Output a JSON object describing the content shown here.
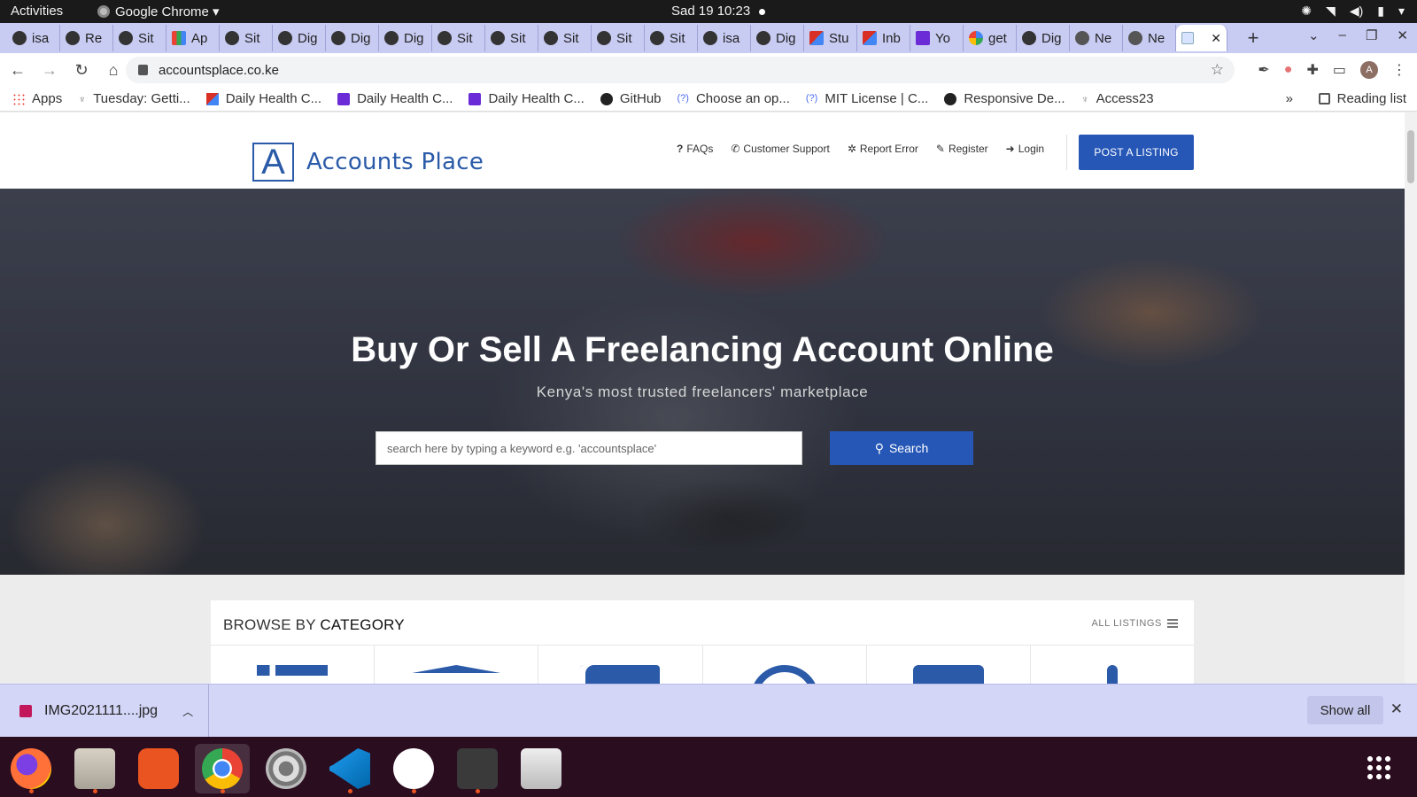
{
  "system": {
    "activities": "Activities",
    "app_menu": "Google Chrome ▾",
    "clock": "Sad 19  10:23"
  },
  "tabs": [
    {
      "label": "isa",
      "icon": "github-icon"
    },
    {
      "label": "Re",
      "icon": "github-icon"
    },
    {
      "label": "Sit",
      "icon": "github-icon"
    },
    {
      "label": "Ap",
      "icon": "apps-grid-icon"
    },
    {
      "label": "Sit",
      "icon": "github-icon"
    },
    {
      "label": "Dig",
      "icon": "github-icon"
    },
    {
      "label": "Dig",
      "icon": "github-icon"
    },
    {
      "label": "Dig",
      "icon": "github-icon"
    },
    {
      "label": "Sit",
      "icon": "github-icon"
    },
    {
      "label": "Sit",
      "icon": "github-icon"
    },
    {
      "label": "Sit",
      "icon": "github-icon"
    },
    {
      "label": "Sit",
      "icon": "github-icon"
    },
    {
      "label": "Sit",
      "icon": "github-icon"
    },
    {
      "label": "isa",
      "icon": "github-icon"
    },
    {
      "label": "Dig",
      "icon": "github-icon"
    },
    {
      "label": "Stu",
      "icon": "gmail-icon"
    },
    {
      "label": "Inb",
      "icon": "gmail-icon"
    },
    {
      "label": "Yo",
      "icon": "forms-icon"
    },
    {
      "label": "get",
      "icon": "google-icon"
    },
    {
      "label": "Dig",
      "icon": "github-icon"
    },
    {
      "label": "Ne",
      "icon": "globe-icon"
    },
    {
      "label": "Ne",
      "icon": "globe-icon"
    }
  ],
  "active_tab": {
    "label": "",
    "close": "✕"
  },
  "new_tab": "+",
  "url": "accountsplace.co.ke",
  "bookmarks": [
    {
      "label": "Apps",
      "icon": "apps"
    },
    {
      "label": "Tuesday: Getti...",
      "icon": "palm"
    },
    {
      "label": "Daily Health C...",
      "icon": "gm"
    },
    {
      "label": "Daily Health C...",
      "icon": "pu"
    },
    {
      "label": "Daily Health C...",
      "icon": "pu"
    },
    {
      "label": "GitHub",
      "icon": "gh"
    },
    {
      "label": "Choose an op...",
      "icon": "q"
    },
    {
      "label": "MIT License | C...",
      "icon": "q"
    },
    {
      "label": "Responsive De...",
      "icon": "rd"
    },
    {
      "label": "Access23",
      "icon": "palm"
    }
  ],
  "bookmarks_more": "»",
  "reading_list": "Reading list",
  "site": {
    "logo_letter": "A",
    "logo_name": "Accounts Place",
    "nav": [
      {
        "icon": "?",
        "label": "FAQs",
        "icon_name": "question-icon"
      },
      {
        "icon": "✆",
        "label": "Customer Support",
        "icon_name": "phone-icon"
      },
      {
        "icon": "✲",
        "label": "Report Error",
        "icon_name": "bug-icon"
      },
      {
        "icon": "✎",
        "label": "Register",
        "icon_name": "edit-icon"
      },
      {
        "icon": "➜",
        "label": "Login",
        "icon_name": "sign-in-icon"
      }
    ],
    "post_listing": "POST A LISTING",
    "hero_title": "Buy Or Sell A Freelancing Account Online",
    "hero_subtitle": "Kenya's most trusted freelancers' marketplace",
    "search_placeholder": "search here by typing a keyword e.g. 'accountsplace'",
    "search_button": "Search",
    "browse_prefix": "BROWSE BY",
    "browse_strong": "CATEGORY",
    "all_listings": "ALL LISTINGS"
  },
  "downloads": {
    "file": "IMG2021111....jpg",
    "show_all": "Show all",
    "close": "✕"
  },
  "dock_apps": [
    "firefox",
    "files",
    "ubuntu-software",
    "chrome",
    "settings",
    "vscode",
    "slack",
    "terminal",
    "screenshot"
  ]
}
